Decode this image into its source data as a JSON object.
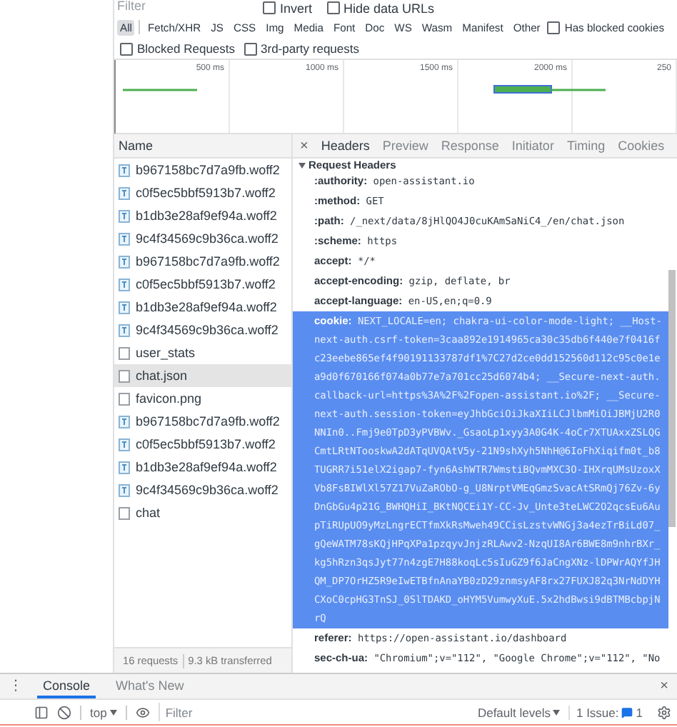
{
  "filter": {
    "placeholder": "Filter"
  },
  "top_options": [
    {
      "label": "Invert",
      "checked": false
    },
    {
      "label": "Hide data URLs",
      "checked": false
    }
  ],
  "type_filters": [
    {
      "label": "All",
      "selected": true
    },
    {
      "label": "Fetch/XHR",
      "selected": false
    },
    {
      "label": "JS",
      "selected": false
    },
    {
      "label": "CSS",
      "selected": false
    },
    {
      "label": "Img",
      "selected": false
    },
    {
      "label": "Media",
      "selected": false
    },
    {
      "label": "Font",
      "selected": false
    },
    {
      "label": "Doc",
      "selected": false
    },
    {
      "label": "WS",
      "selected": false
    },
    {
      "label": "Wasm",
      "selected": false
    },
    {
      "label": "Manifest",
      "selected": false
    },
    {
      "label": "Other",
      "selected": false
    }
  ],
  "has_blocked_cookies": {
    "label": "Has blocked cookies",
    "checked": false
  },
  "options": [
    {
      "label": "Blocked Requests",
      "checked": false
    },
    {
      "label": "3rd-party requests",
      "checked": false
    }
  ],
  "timeline": {
    "ticks": [
      "500 ms",
      "1000 ms",
      "1500 ms",
      "2000 ms",
      "250"
    ]
  },
  "requests": {
    "column": "Name",
    "items": [
      {
        "name": "b967158bc7d7a9fb.woff2",
        "kind": "font",
        "selected": false
      },
      {
        "name": "c0f5ec5bbf5913b7.woff2",
        "kind": "font",
        "selected": false
      },
      {
        "name": "b1db3e28af9ef94a.woff2",
        "kind": "font",
        "selected": false
      },
      {
        "name": "9c4f34569c9b36ca.woff2",
        "kind": "font",
        "selected": false
      },
      {
        "name": "b967158bc7d7a9fb.woff2",
        "kind": "font",
        "selected": false
      },
      {
        "name": "c0f5ec5bbf5913b7.woff2",
        "kind": "font",
        "selected": false
      },
      {
        "name": "b1db3e28af9ef94a.woff2",
        "kind": "font",
        "selected": false
      },
      {
        "name": "9c4f34569c9b36ca.woff2",
        "kind": "font",
        "selected": false
      },
      {
        "name": "user_stats",
        "kind": "doc",
        "selected": false
      },
      {
        "name": "chat.json",
        "kind": "doc",
        "selected": true
      },
      {
        "name": "favicon.png",
        "kind": "doc",
        "selected": false
      },
      {
        "name": "b967158bc7d7a9fb.woff2",
        "kind": "font",
        "selected": false
      },
      {
        "name": "c0f5ec5bbf5913b7.woff2",
        "kind": "font",
        "selected": false
      },
      {
        "name": "b1db3e28af9ef94a.woff2",
        "kind": "font",
        "selected": false
      },
      {
        "name": "9c4f34569c9b36ca.woff2",
        "kind": "font",
        "selected": false
      },
      {
        "name": "chat",
        "kind": "doc",
        "selected": false
      }
    ]
  },
  "summary": {
    "requests": "16 requests",
    "transferred": "9.3 kB transferred"
  },
  "detail_close": "×",
  "detail_tabs": [
    {
      "label": "Headers",
      "selected": true
    },
    {
      "label": "Preview",
      "selected": false
    },
    {
      "label": "Response",
      "selected": false
    },
    {
      "label": "Initiator",
      "selected": false
    },
    {
      "label": "Timing",
      "selected": false
    },
    {
      "label": "Cookies",
      "selected": false
    }
  ],
  "request_headers": {
    "title": "Request Headers",
    "rows": [
      {
        "name": ":authority:",
        "value": "open-assistant.io",
        "selected": false
      },
      {
        "name": ":method:",
        "value": "GET",
        "selected": false
      },
      {
        "name": ":path:",
        "value": "/_next/data/8jHlQO4J0cuKAmSaNiC4_/en/chat.json",
        "selected": false
      },
      {
        "name": ":scheme:",
        "value": "https",
        "selected": false
      },
      {
        "name": "accept:",
        "value": "*/*",
        "selected": false
      },
      {
        "name": "accept-encoding:",
        "value": "gzip, deflate, br",
        "selected": false
      },
      {
        "name": "accept-language:",
        "value": "en-US,en;q=0.9",
        "selected": false
      },
      {
        "name": "cookie:",
        "value": "NEXT_LOCALE=en; chakra-ui-color-mode-light; __Host-next-auth.csrf-token=3caa892e1914965ca30c35db6f440e7f0416fc23eebe865ef4f90191133787df1%7C27d2ce0dd152560d112c95c0e1ea9d0f670166f074a0b77e7a701cc25d6074b4; __Secure-next-auth.callback-url=https%3A%2F%2Fopen-assistant.io%2F; __Secure-next-auth.session-token=eyJhbGciOiJkaXIiLCJlbmMiOiJBMjU2R0NNIn0..Fmj9e0TpD3yPVBWv._GsaoLp1xyy3A0G4K-4oCr7XTUAxxZSLQGCmtLRtNTooskwA2dATqUVQAtV5y-21N9shXyh5NhH@6IoFhXiqifm0t_b8TUGRR7i51elX2igap7-fyn6AshWTR7WmstiBQvmMXC3O-IHXrqUMsUzoxXVb8FsBIWlXl57Z17VuZaRObO-g_U8NrptVMEqGmzSvacAtSRmQj76Zv-6yDnGbGu4p21G_BWHQHiI_BKtNQCEi1Y-CC-Jv_Unte3teLWC2O2qcsEu6AupTiRUpUO9yMzLngrECTfmXkRsMweh49CCisLzstvWNGj3a4ezTrBiLd07_gQeWATM78sKQjHPqXPa1pzqyvJnjzRLAwv2-NzqUI8Ar6BWE8m9nhrBXr_kg5hRzn3qsJyt77n4zgE7H88koqLc5sIuGZ9f6JaCngXNz-lDPWrAQYfJHQM_DP7OrHZ5R9eIwETBfnAnaYB0zD29znmsyAF8rx27FUXJ82q3NrNdDYHCXoC0cpHG3TnSJ_0SlTDAKD_oHYM5VumwyXuE.5x2hdBwsi9dBTMBcbpjNrQ",
        "selected": true
      },
      {
        "name": "referer:",
        "value": "https://open-assistant.io/dashboard",
        "selected": false
      },
      {
        "name": "sec-ch-ua:",
        "value": "\"Chromium\";v=\"112\", \"Google Chrome\";v=\"112\", \"No",
        "selected": false
      }
    ]
  },
  "drawer": {
    "menu": "⋮",
    "tabs": [
      {
        "label": "Console",
        "selected": true
      },
      {
        "label": "What's New",
        "selected": false
      }
    ],
    "close": "×"
  },
  "console_toolbar": {
    "context": "top",
    "filter_placeholder": "Filter",
    "levels": "Default levels",
    "issues_label": "1 Issue:",
    "issues_count": "1"
  }
}
